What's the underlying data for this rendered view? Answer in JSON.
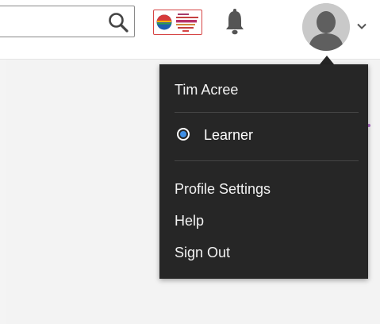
{
  "header": {
    "search": {
      "value": "",
      "placeholder": "",
      "button_icon": "search-icon"
    },
    "logo_icon": "brand-logo",
    "notifications_icon": "bell-icon",
    "avatar_icon": "user-avatar",
    "menu_toggle_icon": "chevron-down-icon"
  },
  "user_menu": {
    "user_name": "Tim Acree",
    "roles": [
      {
        "label": "Learner",
        "selected": true
      }
    ],
    "items": [
      {
        "label": "Profile Settings"
      },
      {
        "label": "Help"
      },
      {
        "label": "Sign Out"
      }
    ]
  },
  "colors": {
    "menu_background": "#262626",
    "radio_selected": "#3f8fe6",
    "logo_border": "#d64545",
    "page_background": "#f3f3f3"
  }
}
